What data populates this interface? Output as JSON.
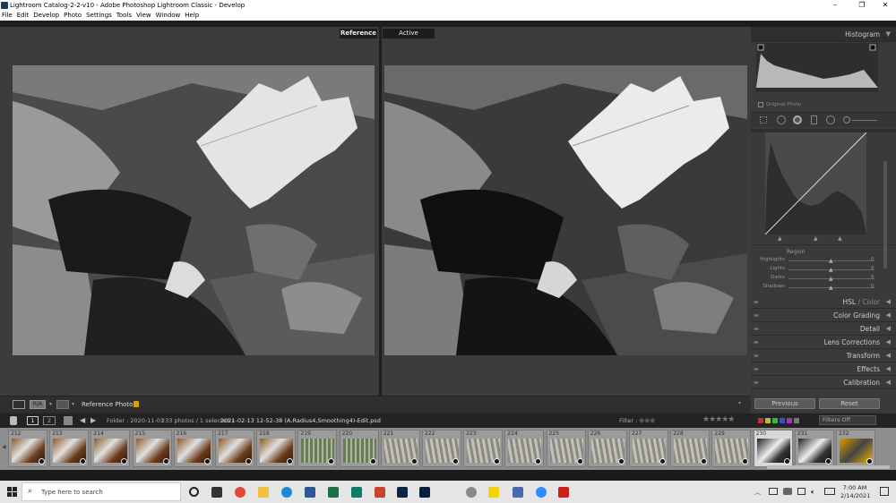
{
  "window": {
    "title": "Lightroom Catalog-2-2-v10 - Adobe Photoshop Lightroom Classic - Develop",
    "minimize": "–",
    "maximize": "❐",
    "close": "✕"
  },
  "menu": [
    "File",
    "Edit",
    "Develop",
    "Photo",
    "Settings",
    "Tools",
    "View",
    "Window",
    "Help"
  ],
  "view": {
    "reference_label": "Reference",
    "active_label": "Active"
  },
  "toolbar": {
    "reference_photo_label": "Reference Photo :",
    "lock_icon": "lock-icon"
  },
  "histogram": {
    "title": "Histogram",
    "original_photo": "Original Photo"
  },
  "tone_curve": {
    "region_label": "Region",
    "sliders": [
      {
        "label": "Highlights",
        "value": "0",
        "level": 0.5
      },
      {
        "label": "Lights",
        "value": "0",
        "level": 0.5
      },
      {
        "label": "Darks",
        "value": "0",
        "level": 0.5
      },
      {
        "label": "Shadows",
        "value": "0",
        "level": 0.5
      }
    ]
  },
  "panels": [
    {
      "label": "HSL",
      "label2": " / Color"
    },
    {
      "label": "Color Grading",
      "label2": ""
    },
    {
      "label": "Detail",
      "label2": ""
    },
    {
      "label": "Lens Corrections",
      "label2": ""
    },
    {
      "label": "Transform",
      "label2": ""
    },
    {
      "label": "Effects",
      "label2": ""
    },
    {
      "label": "Calibration",
      "label2": ""
    }
  ],
  "buttons": {
    "previous": "Previous",
    "reset": "Reset"
  },
  "filmstrip_header": {
    "page1": "1",
    "page2": "2",
    "folder": "Folder : 2020-11-01",
    "count": "233 photos / 1 selected /",
    "filename": "2021-02-13 12-52-38 (A,Radius4,Smoothing4)-Edit.psd",
    "filter_label": "Filter :",
    "filters_off": "Filters Off"
  },
  "thumbnails": [
    {
      "num": "212",
      "kind": "leaf"
    },
    {
      "num": "213",
      "kind": "leaf"
    },
    {
      "num": "214",
      "kind": "leaf"
    },
    {
      "num": "215",
      "kind": "leaf"
    },
    {
      "num": "216",
      "kind": "leaf"
    },
    {
      "num": "217",
      "kind": "leaf"
    },
    {
      "num": "218",
      "kind": "leaf"
    },
    {
      "num": "219",
      "kind": "green"
    },
    {
      "num": "220",
      "kind": "green"
    },
    {
      "num": "221",
      "kind": "gray"
    },
    {
      "num": "222",
      "kind": "gray"
    },
    {
      "num": "223",
      "kind": "gray"
    },
    {
      "num": "224",
      "kind": "gray"
    },
    {
      "num": "225",
      "kind": "gray"
    },
    {
      "num": "226",
      "kind": "gray"
    },
    {
      "num": "227",
      "kind": "gray"
    },
    {
      "num": "228",
      "kind": "gray"
    },
    {
      "num": "229",
      "kind": "gray"
    },
    {
      "num": "230",
      "kind": "bw"
    },
    {
      "num": "231",
      "kind": "bw"
    },
    {
      "num": "232",
      "kind": "yellow"
    }
  ],
  "taskbar": {
    "search_placeholder": "Type here to search",
    "time": "7:00 AM",
    "date": "2/14/2021",
    "app_icons": [
      "task-view-icon",
      "chrome-icon",
      "file-explorer-icon",
      "edge-icon",
      "word-icon",
      "excel-icon",
      "publisher-icon",
      "powerpoint-icon",
      "lightroom-icon",
      "photoshop-icon",
      "camera-icon",
      "sticky-notes-icon",
      "calculator-icon",
      "zoom-icon",
      "acrobat-icon"
    ]
  },
  "colors": {
    "accent": "#0078d7",
    "panel_bg": "#3a3a3a",
    "filmstrip_bg": "#8e8e8e"
  }
}
